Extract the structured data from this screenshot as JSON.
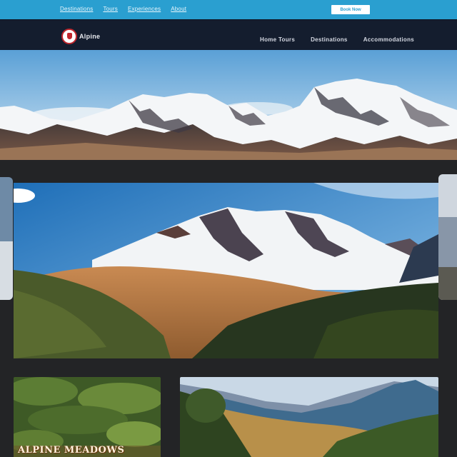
{
  "topbar": {
    "links": [
      "Destinations",
      "Tours",
      "Experiences",
      "About"
    ],
    "cta_label": "Book Now"
  },
  "nav": {
    "logo_text": "Alpine",
    "links": [
      "Home  Tours",
      "Destinations",
      "Accommodations"
    ]
  },
  "hero": {
    "image": "snow-capped-mountain-range"
  },
  "feature": {
    "image": "volcano-valley-landscape"
  },
  "cards": [
    {
      "title": "ALPINE MEADOWS",
      "image": "green-meadow"
    },
    {
      "title": "",
      "image": "mountain-valley-forest"
    }
  ],
  "colors": {
    "topbar": "#2a9fd0",
    "nav": "#141d2e",
    "page": "#232426",
    "logo_accent": "#c0272d"
  }
}
